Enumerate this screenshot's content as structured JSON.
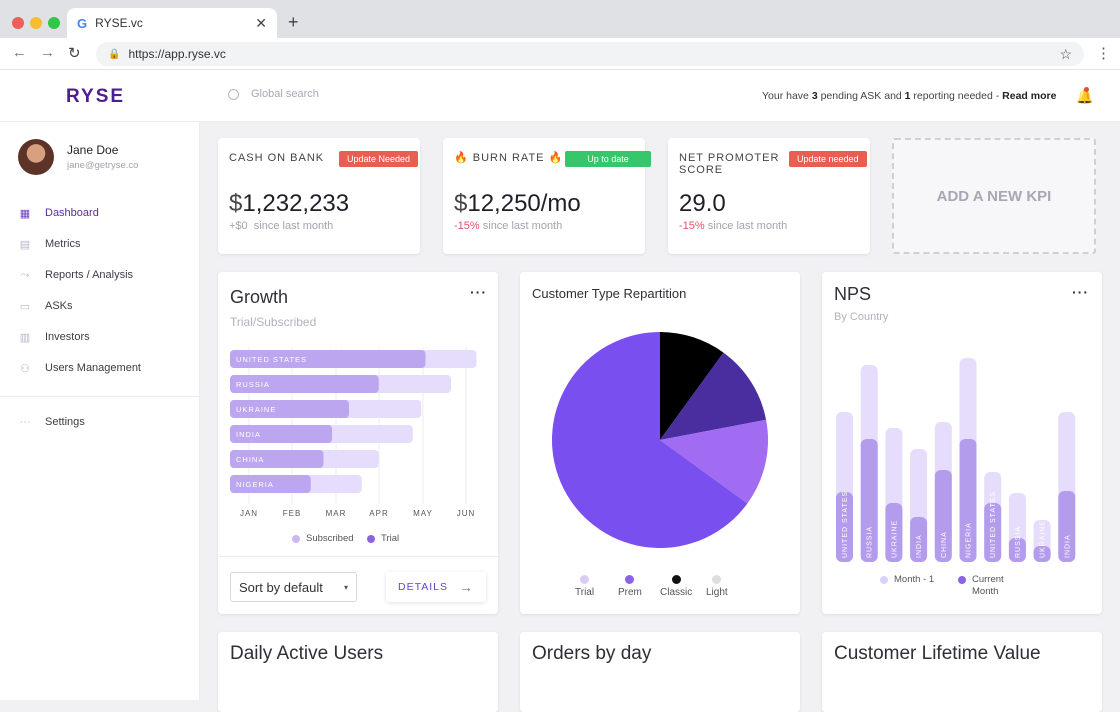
{
  "browser": {
    "tab_title": "RYSE.vc",
    "tab_icon": "G",
    "url": "https://app.ryse.vc"
  },
  "topbar": {
    "logo": "RYSE",
    "search_placeholder": "Global search",
    "pending_prefix": "Your have ",
    "pending_asks": "3",
    "pending_mid": " pending ASK and ",
    "pending_reports": "1",
    "pending_suffix": " reporting needed - ",
    "read_more": "Read more"
  },
  "user": {
    "name": "Jane Doe",
    "email": "jane@getryse.co"
  },
  "sidebar": {
    "items": [
      {
        "label": "Dashboard",
        "icon": "grid-icon"
      },
      {
        "label": "Metrics",
        "icon": "chart-icon"
      },
      {
        "label": "Reports / Analysis",
        "icon": "trend-icon"
      },
      {
        "label": "ASKs",
        "icon": "chat-icon"
      },
      {
        "label": "Investors",
        "icon": "building-icon"
      },
      {
        "label": "Users Management",
        "icon": "users-icon"
      }
    ],
    "settings": "Settings"
  },
  "kpis": [
    {
      "label": "CASH ON BANK",
      "badge": "Update Needed",
      "badge_color": "#e85f52",
      "currency": "$",
      "value": "1,232,233",
      "delta": "+$0",
      "delta_text": "since last month"
    },
    {
      "label": "🔥 BURN RATE 🔥",
      "badge": "Up to date",
      "badge_color": "#35c76a",
      "currency": "$",
      "value": "12,250/mo",
      "delta": "-15%",
      "delta_text": "since last month"
    },
    {
      "label1": "NET PROMOTER",
      "label2": "SCORE",
      "badge": "Update needed",
      "badge_color": "#e85f52",
      "value": "29.0",
      "delta": "-15%",
      "delta_text": "since last month"
    }
  ],
  "add_kpi": "ADD A NEW KPI",
  "growth": {
    "title": "Growth",
    "subtitle": "Trial/Subscribed",
    "months": [
      "JAN",
      "FEB",
      "MAR",
      "APR",
      "MAY",
      "JUN"
    ],
    "legend": [
      "Subscribed",
      "Trial"
    ],
    "sort_label": "Sort by default",
    "details_label": "DETAILS"
  },
  "customer_type": {
    "title": "Customer Type Repartition",
    "legend": [
      "Trial",
      "Prem",
      "Classic",
      "Light"
    ]
  },
  "nps": {
    "title": "NPS",
    "subtitle": "By Country",
    "legend": [
      "Month - 1",
      "Current Month"
    ]
  },
  "bottom_cards": [
    "Daily Active Users",
    "Orders by day",
    "Customer Lifetime Value"
  ],
  "colors": {
    "accent": "#6b3fc2",
    "purple_light": "#e6dcfb",
    "purple_mid": "#c6b1f3",
    "purple_dark": "#a98be8",
    "pie_main": "#7a4ff0",
    "pie_dark": "#4a2ea0",
    "pie_light": "#a26cf2"
  },
  "chart_data": [
    {
      "type": "bar",
      "orientation": "horizontal",
      "categories": [
        "UNITED STATES",
        "RUSSIA",
        "UKRAINE",
        "INDIA",
        "CHINA",
        "NIGERIA"
      ],
      "series": [
        {
          "name": "Trial",
          "values": [
            5.8,
            5.2,
            4.5,
            4.3,
            3.5,
            3.1
          ]
        },
        {
          "name": "Subscribed",
          "values": [
            4.6,
            3.5,
            2.8,
            2.4,
            2.2,
            1.9
          ]
        }
      ],
      "xlabel": "",
      "xticks": [
        "JAN",
        "FEB",
        "MAR",
        "APR",
        "MAY",
        "JUN"
      ],
      "xlim": [
        0,
        6
      ]
    },
    {
      "type": "pie",
      "title": "Customer Type Repartition",
      "categories": [
        "Trial",
        "Prem",
        "Classic",
        "Light"
      ],
      "values": [
        65,
        12,
        10,
        13
      ]
    },
    {
      "type": "bar",
      "categories": [
        "UNITED STATES",
        "RUSSIA",
        "UKRAINE",
        "INDIA",
        "CHINA",
        "NIGERIA",
        "UNITED STATES",
        "RUSSIA",
        "UKRAINE",
        "INDIA"
      ],
      "series": [
        {
          "name": "Month - 1",
          "values": [
            150,
            197,
            134,
            113,
            140,
            204,
            90,
            69,
            42,
            150
          ]
        },
        {
          "name": "Current Month",
          "values": [
            70,
            123,
            59,
            45,
            92,
            123,
            59,
            24,
            16,
            71
          ]
        }
      ]
    }
  ]
}
